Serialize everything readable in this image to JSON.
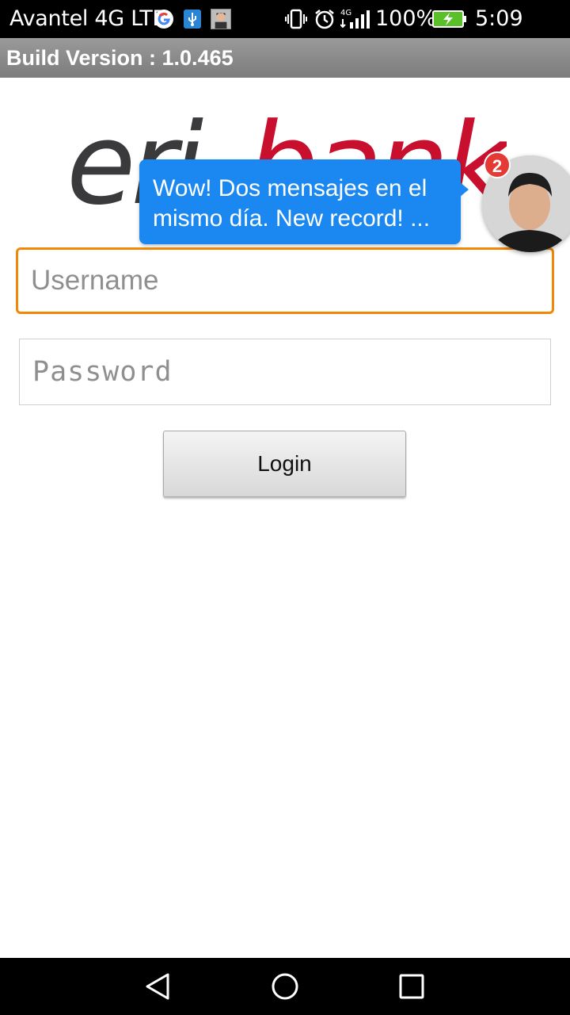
{
  "status_bar": {
    "carrier": "Avantel 4G LTE",
    "network_label": "4G",
    "battery_percent": "100%",
    "time": "5:09 p.m."
  },
  "build_bar": {
    "text": "Build Version : 1.0.465"
  },
  "logo": {
    "text_dark": "eri",
    "text_red": "bank",
    "color_dark": "#3a3a3c",
    "color_red": "#c8102e"
  },
  "form": {
    "username_placeholder": "Username",
    "password_placeholder": "Password",
    "login_label": "Login",
    "focus_color": "#f0880a"
  },
  "chat": {
    "message_line1": "Wow! Dos mensajes en el",
    "message_line2": "mismo día. New record! ...",
    "badge_count": "2",
    "bubble_color": "#1a88f0"
  }
}
